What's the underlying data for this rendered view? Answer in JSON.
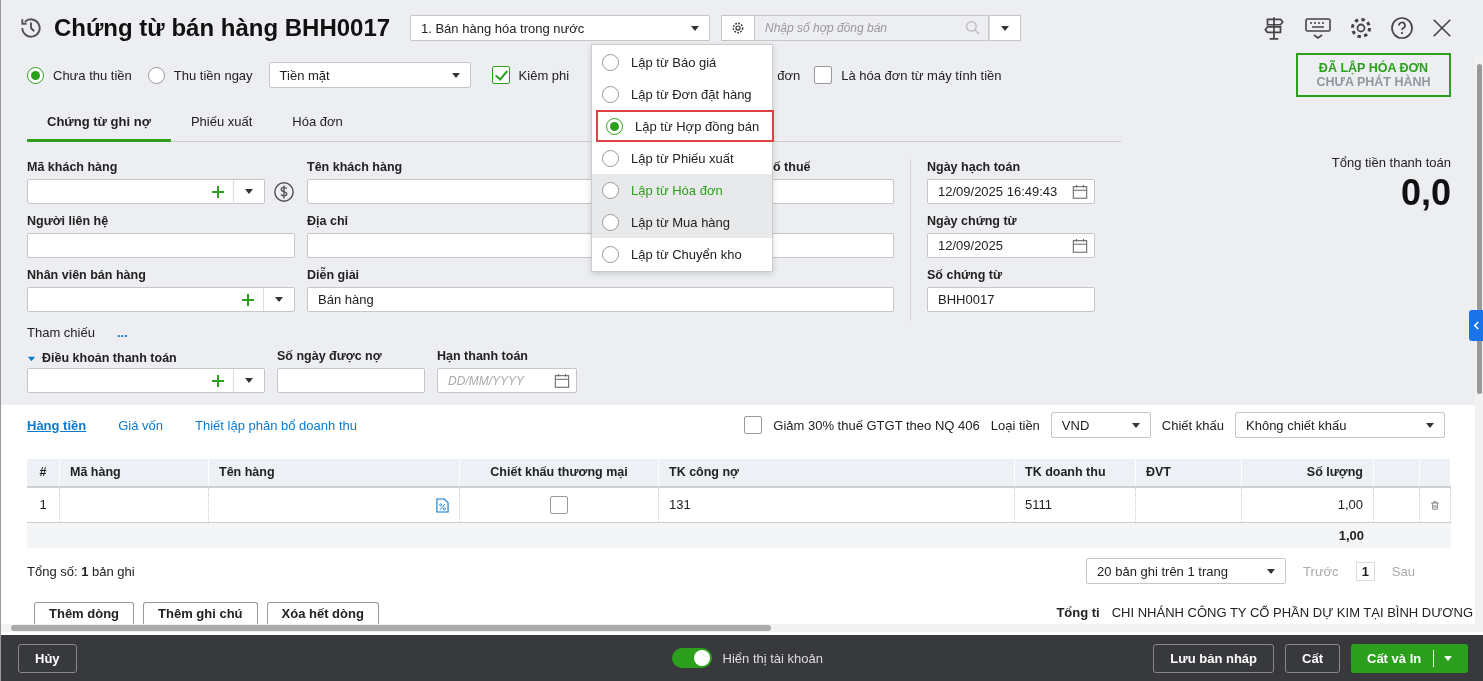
{
  "header": {
    "title": "Chứng từ bán hàng BHH0017",
    "voucher_type": "1. Bán hàng hóa trong nước",
    "contract_search": {
      "placeholder": "Nhập số hợp đồng bán"
    }
  },
  "source_menu": {
    "items": [
      {
        "label": "Lập từ Báo giá",
        "selected": false,
        "outlined": false,
        "hovered": false,
        "shaded": false
      },
      {
        "label": "Lập từ Đơn đặt hàng",
        "selected": false,
        "outlined": false,
        "hovered": false,
        "shaded": false
      },
      {
        "label": "Lập từ Hợp đồng bán",
        "selected": true,
        "outlined": true,
        "hovered": false,
        "shaded": false
      },
      {
        "label": "Lập từ Phiếu xuất",
        "selected": false,
        "outlined": false,
        "hovered": false,
        "shaded": false
      },
      {
        "label": "Lập từ Hóa đơn",
        "selected": false,
        "outlined": false,
        "hovered": true,
        "shaded": true
      },
      {
        "label": "Lập từ Mua hàng",
        "selected": false,
        "outlined": false,
        "hovered": false,
        "shaded": true
      },
      {
        "label": "Lập từ Chuyển kho",
        "selected": false,
        "outlined": false,
        "hovered": false,
        "shaded": false
      }
    ]
  },
  "payment": {
    "options": [
      {
        "label": "Chưa thu tiền",
        "selected": true
      },
      {
        "label": "Thu tiền ngay",
        "selected": false
      }
    ],
    "method": "Tiền mặt"
  },
  "checkboxes": [
    {
      "label": "Kiêm phi",
      "trailing": "đơn",
      "checked": true
    },
    {
      "label": "Là hóa đơn từ máy tính tiền",
      "checked": false
    }
  ],
  "status_badge": {
    "line_1": "ĐÃ LẬP HÓA ĐƠN",
    "line_2": "CHƯA PHÁT HÀNH"
  },
  "tabs": [
    {
      "label": "Chứng từ ghi nợ",
      "selected": true
    },
    {
      "label": "Phiếu xuất",
      "selected": false
    },
    {
      "label": "Hóa đơn",
      "selected": false
    }
  ],
  "customer": {
    "code_label": "Mã khách hàng",
    "name_label": "Tên khách hàng",
    "tax_label": "ố thuế",
    "contact_label": "Người liên hệ",
    "address_label": "Địa chỉ",
    "salesperson_label": "Nhân viên bán hàng",
    "description_label": "Diễn giải",
    "description": "Bán hàng"
  },
  "dates": {
    "posting_label": "Ngày hạch toán",
    "posting": "12/09/2025 16:49:43",
    "voucher_date_label": "Ngày chứng từ",
    "voucher_date": "12/09/2025",
    "number_label": "Số chứng từ",
    "number": "BHH0017"
  },
  "reference": {
    "label": "Tham chiếu",
    "link": "..."
  },
  "terms": {
    "label": "Điều khoản thanh toán",
    "expanded": true,
    "days_label": "Số ngày được nợ",
    "due_label": "Hạn thanh toán",
    "due_placeholder": "DD/MM/YYYY"
  },
  "total": {
    "label": "Tổng tiền thanh toán",
    "value": "0,0"
  },
  "detail_tabs": [
    {
      "label": "Hàng tiền",
      "selected": true
    },
    {
      "label": "Giá vốn",
      "selected": false
    },
    {
      "label": "Thiết lập phân bổ doanh thu",
      "selected": false
    }
  ],
  "options": {
    "vat_cut": {
      "label": "Giảm 30% thuế GTGT theo NQ 406",
      "checked": false
    },
    "currency_label": "Loại tiền",
    "currency": "VND",
    "discount_label": "Chiết khấu",
    "discount": "Không chiết khấu"
  },
  "table": {
    "columns": [
      "#",
      "Mã hàng",
      "Tên hàng",
      "Chiết khấu thương mại",
      "TK công nợ",
      "TK doanh thu",
      "ĐVT",
      "Số lượng"
    ],
    "rows": [
      {
        "index": "1",
        "trade_discount": false,
        "receivable_account": "131",
        "revenue_account": "5111",
        "quantity": "1,00"
      }
    ],
    "total_quantity": "1,00"
  },
  "pagination": {
    "count": "Tổng số: **1** bản ghi",
    "page_size": "20 bản ghi trên 1 trang",
    "prev": "Trước",
    "page": "1",
    "next": "Sau"
  },
  "row_buttons": [
    "Thêm dòng",
    "Thêm ghi chú",
    "Xóa hết dòng"
  ],
  "footer_note": {
    "label": "Tổng ti",
    "value": "CHI NHÁNH CÔNG TY CỔ PHẦN DỰ KIM TẠI BÌNH DƯƠNG"
  },
  "bottom_bar": {
    "cancel": "Hủy",
    "show_accounts": {
      "label": "Hiển thị tài khoản",
      "on": true
    },
    "buttons": [
      "Lưu bản nháp",
      "Cất"
    ],
    "primary": "Cất và In"
  }
}
